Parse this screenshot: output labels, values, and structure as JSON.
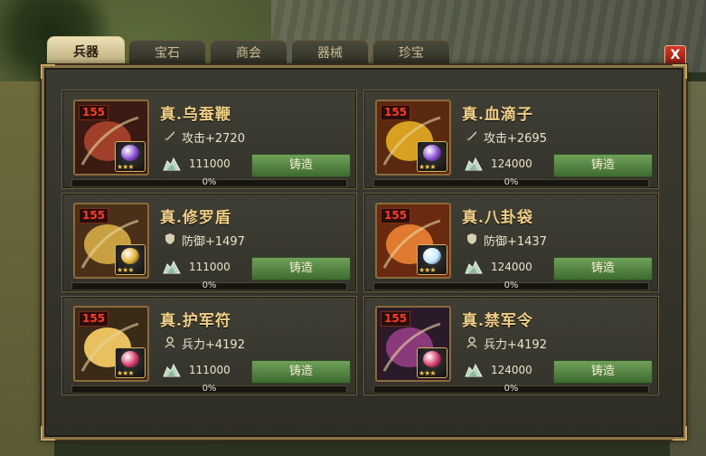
{
  "tabs": [
    {
      "label": "兵器",
      "active": true
    },
    {
      "label": "宝石",
      "active": false
    },
    {
      "label": "商会",
      "active": false
    },
    {
      "label": "器械",
      "active": false
    },
    {
      "label": "珍宝",
      "active": false
    }
  ],
  "close_label": "X",
  "forge_label": "铸造",
  "items": [
    {
      "level": "155",
      "name": "真.乌蚕鞭",
      "stat_icon": "sword-icon",
      "stat": "攻击+2720",
      "cost": "111000",
      "progress": "0%",
      "progress_fraction": 0,
      "gem_color": "#8a4bd6"
    },
    {
      "level": "155",
      "name": "真.血滴子",
      "stat_icon": "sword-icon",
      "stat": "攻击+2695",
      "cost": "124000",
      "progress": "0%",
      "progress_fraction": 0,
      "gem_color": "#8a4bd6"
    },
    {
      "level": "155",
      "name": "真.修罗盾",
      "stat_icon": "shield-icon",
      "stat": "防御+1497",
      "cost": "111000",
      "progress": "0%",
      "progress_fraction": 0,
      "gem_color": "#e0b030"
    },
    {
      "level": "155",
      "name": "真.八卦袋",
      "stat_icon": "shield-icon",
      "stat": "防御+1437",
      "cost": "124000",
      "progress": "0%",
      "progress_fraction": 0,
      "gem_color": "#bfe8ff"
    },
    {
      "level": "155",
      "name": "真.护军符",
      "stat_icon": "soldier-icon",
      "stat": "兵力+4192",
      "cost": "111000",
      "progress": "0%",
      "progress_fraction": 0,
      "gem_color": "#d63a6a"
    },
    {
      "level": "155",
      "name": "真.禁军令",
      "stat_icon": "soldier-icon",
      "stat": "兵力+4192",
      "cost": "124000",
      "progress": "0%",
      "progress_fraction": 0,
      "gem_color": "#d63a6a"
    }
  ],
  "colors": {
    "title_gold": "#f0cf86",
    "level_red": "#ff3b2a",
    "forge_green": "#4e8a3e",
    "frame_bronze": "#8b7447"
  }
}
